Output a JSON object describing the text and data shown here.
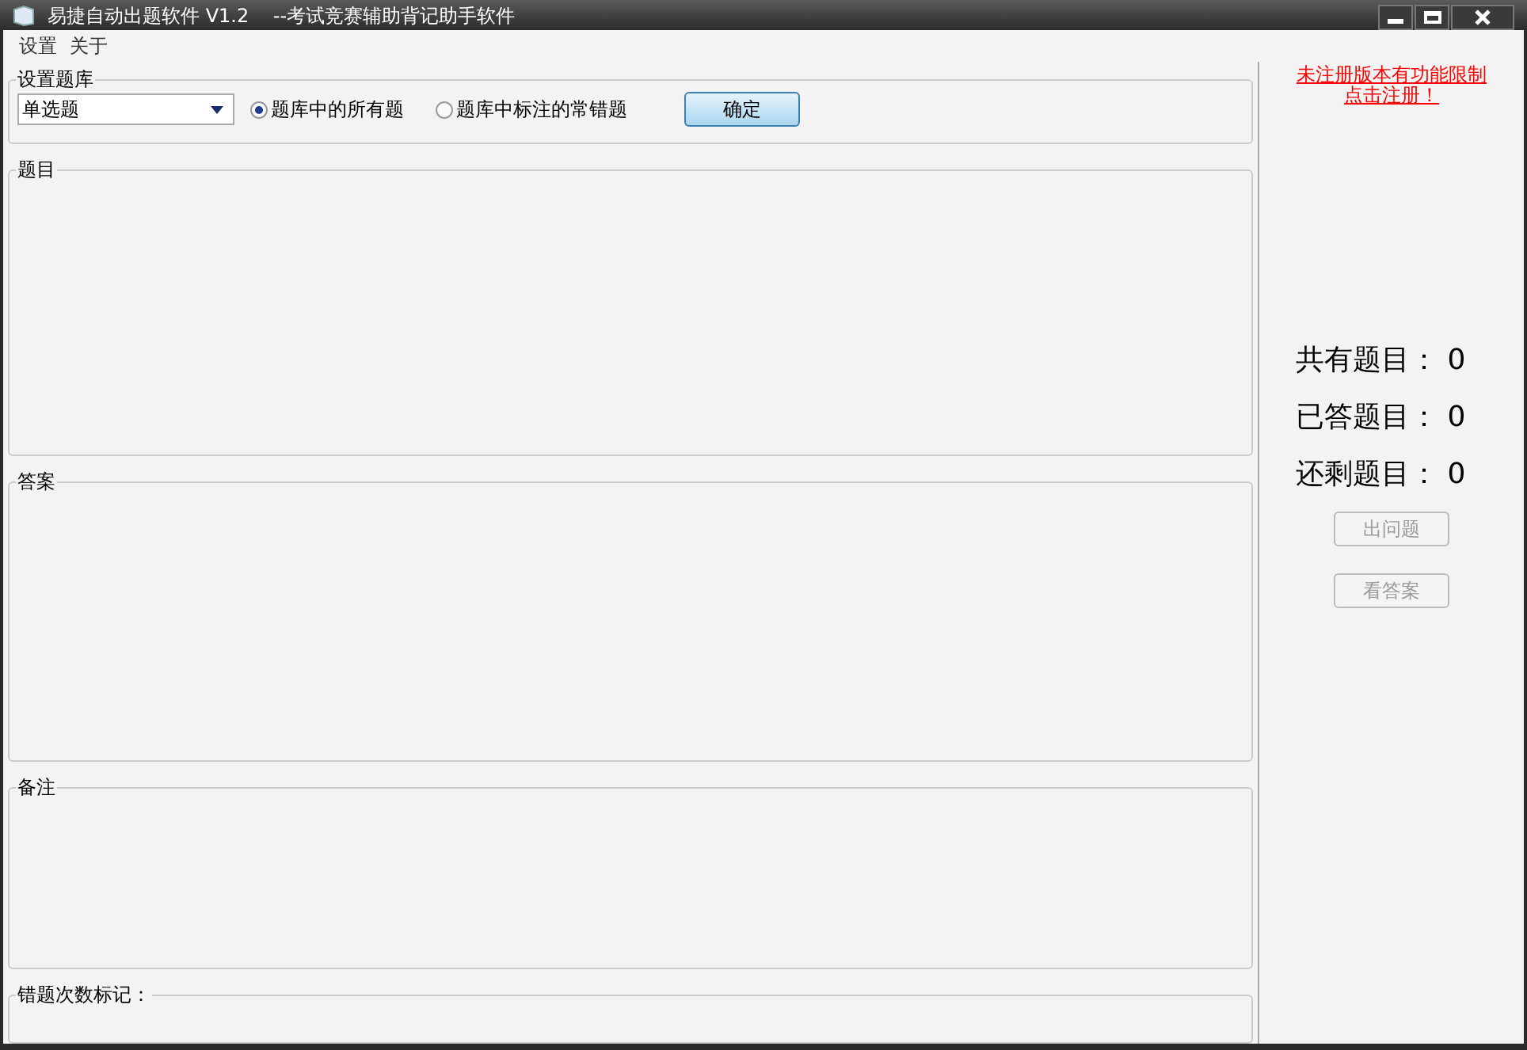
{
  "window": {
    "title": "易捷自动出题软件 V1.2    --考试竞赛辅助背记助手软件"
  },
  "menu": [
    "设置",
    "关于"
  ],
  "settings": {
    "legend": "设置题库",
    "dropdown": "单选题",
    "radios": [
      {
        "label": "题库中的所有题",
        "selected": true
      },
      {
        "label": "题库中标注的常错题",
        "selected": false
      }
    ],
    "confirm": "确定"
  },
  "groups": [
    {
      "legend": "题目"
    },
    {
      "legend": "答案"
    },
    {
      "legend": "备注"
    },
    {
      "legend": "错题次数标记："
    }
  ],
  "register": {
    "line1": "未注册版本有功能限制",
    "line2": "点击注册！"
  },
  "stats": [
    {
      "label": "共有题目：",
      "value": "0"
    },
    {
      "label": "已答题目：",
      "value": "0"
    },
    {
      "label": "还剩题目：",
      "value": "0"
    }
  ],
  "actions": [
    {
      "label": "出问题",
      "disabled": true
    },
    {
      "label": "看答案",
      "disabled": true
    }
  ]
}
